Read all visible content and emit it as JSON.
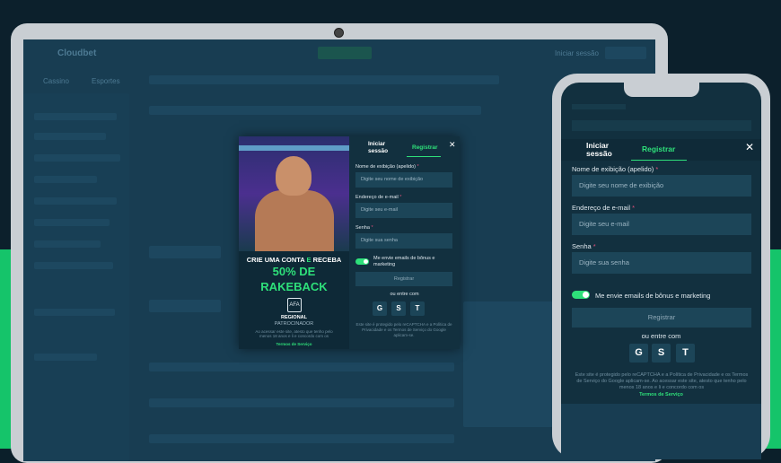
{
  "desktop": {
    "bg_labels": [
      "Cloudbet",
      "Cassino",
      "Esportes",
      "Registrar",
      "Iniciar sessão"
    ],
    "promo": {
      "line1a": "CRIE UMA CONTA",
      "line1b": "E",
      "line1c": "RECEBA",
      "big1": "50% DE",
      "big2": "RAKEBACK",
      "sponsor1": "REGIONAL",
      "sponsor2": "PATROCINADOR",
      "legal": "Ao acessar este site, atesto que tenho pelo menos 18 anos e li e concordo com os",
      "terms": "Termos de Serviço"
    },
    "form": {
      "tab_login": "Iniciar sessão",
      "tab_register": "Registrar",
      "close": "✕",
      "nickname_label": "Nome de exibição (apelido)",
      "nickname_placeholder": "Digite seu nome de exibição",
      "email_label": "Endereço de e-mail",
      "email_placeholder": "Digite seu e-mail",
      "password_label": "Senha",
      "password_placeholder": "Digite sua senha",
      "required_mark": "*",
      "marketing_toggle": "Me envie emails de bônus e marketing",
      "register_button": "Registrar",
      "or_enter_with": "ou entre com",
      "social": [
        "G",
        "S",
        "T"
      ],
      "legal": "Este site é protegido pelo reCAPTCHA e a Política de Privacidade e os Termos de Serviço do Google aplicam-se."
    }
  },
  "mobile": {
    "tab_login": "Iniciar sessão",
    "tab_register": "Registrar",
    "close": "✕",
    "nickname_label": "Nome de exibição (apelido)",
    "nickname_placeholder": "Digite seu nome de exibição",
    "email_label": "Endereço de e-mail",
    "email_placeholder": "Digite seu e-mail",
    "password_label": "Senha",
    "password_placeholder": "Digite sua senha",
    "required_mark": "*",
    "marketing_toggle": "Me envie emails de bônus e marketing",
    "register_button": "Registrar",
    "or_enter_with": "ou entre com",
    "social": [
      "G",
      "S",
      "T"
    ],
    "legal": "Este site é protegido pelo reCAPTCHA e a Política de Privacidade e os Termos de Serviço do Google aplicam-se. Ao acessar este site, atesto que tenho pelo menos 18 anos e li e concordo com os",
    "terms": "Termos de Serviço"
  },
  "colors": {
    "accent_green": "#2ee07a",
    "panel": "#12303f",
    "input": "#1c4558",
    "required": "#e0507a",
    "background_green": "#15c46a"
  },
  "icons": [
    "google-icon",
    "steam-icon",
    "telegram-icon",
    "close-icon",
    "camera-icon"
  ]
}
